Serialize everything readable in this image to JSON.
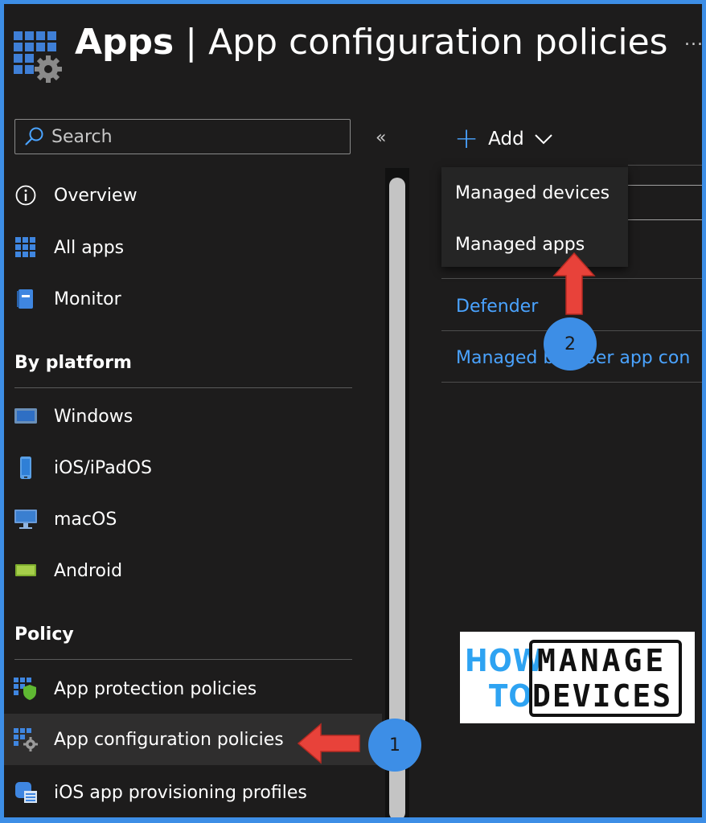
{
  "header": {
    "app_name": "Apps",
    "separator": "|",
    "page_name": "App configuration policies",
    "more": "..."
  },
  "search": {
    "placeholder": "Search"
  },
  "collapse_label": "«",
  "sidebar": {
    "top_items": [
      {
        "label": "Overview",
        "icon": "info-icon"
      },
      {
        "label": "All apps",
        "icon": "grid-icon"
      },
      {
        "label": "Monitor",
        "icon": "monitor-book-icon"
      }
    ],
    "sections": [
      {
        "title": "By platform",
        "items": [
          {
            "label": "Windows",
            "icon": "windows-device-icon"
          },
          {
            "label": "iOS/iPadOS",
            "icon": "phone-icon"
          },
          {
            "label": "macOS",
            "icon": "desktop-icon"
          },
          {
            "label": "Android",
            "icon": "android-device-icon"
          }
        ]
      },
      {
        "title": "Policy",
        "items": [
          {
            "label": "App protection policies",
            "icon": "grid-shield-icon"
          },
          {
            "label": "App configuration policies",
            "icon": "grid-gear-icon",
            "selected": true
          },
          {
            "label": "iOS app provisioning profiles",
            "icon": "profile-icon"
          }
        ]
      }
    ]
  },
  "toolbar": {
    "add_label": "Add"
  },
  "add_menu": {
    "items": [
      "Managed devices",
      "Managed apps"
    ]
  },
  "policy_list": {
    "items": [
      "Defender",
      "Managed browser app con"
    ]
  },
  "annotations": {
    "step1": "1",
    "step2": "2"
  },
  "watermark": {
    "line1_left": "HOW",
    "line2_left": "TO",
    "line1_right": "MANAGE",
    "line2_right": "DEVICES"
  },
  "colors": {
    "background": "#1d1c1c",
    "accent": "#4aa3ff",
    "frame": "#3d8ee6",
    "arrow": "#e8423a"
  }
}
